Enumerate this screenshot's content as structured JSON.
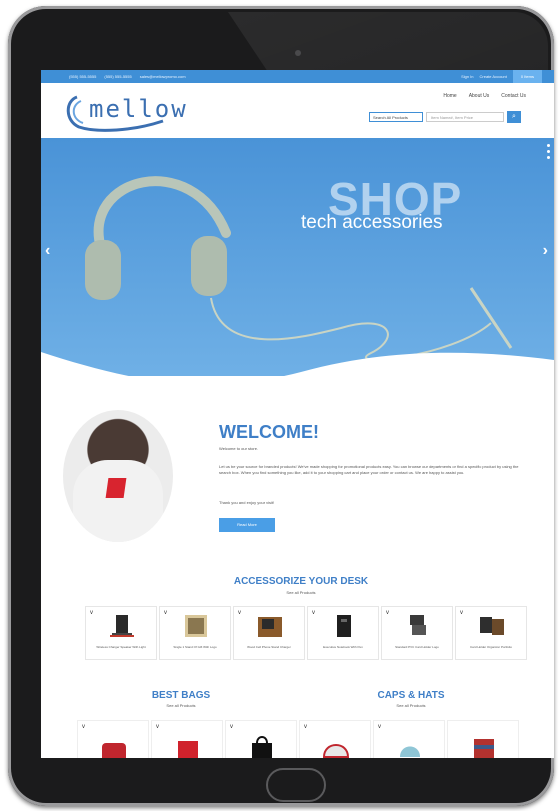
{
  "topbar": {
    "phone": "(555) 555-5555",
    "fax": "(555) 555-5555",
    "email": "sales@mellowpromo.com",
    "sign_in": "Sign In",
    "create_account": "Create Account",
    "cart": "0 Items"
  },
  "header": {
    "logo": "mellow",
    "nav": [
      "Home",
      "About Us",
      "Contact Us"
    ],
    "search_select": "Search All Products",
    "search_placeholder": "Item Name#, Item Price"
  },
  "hero": {
    "title": "SHOP",
    "subtitle": "tech accessories"
  },
  "welcome": {
    "title": "WELCOME!",
    "intro": "Welcome to our store.",
    "body": "Let us be your source for branded products! We've made shopping for promotional products easy. You can browse our departments or find a specific product by using the search box. When you find something you like, add it to your shopping cart and place your order or contact us. We are happy to assist you.",
    "thanks": "Thank you and enjoy your visit!",
    "button": "Read More"
  },
  "desk": {
    "title": "ACCESSORIZE YOUR DESK",
    "subtitle": "See all Products",
    "products": [
      {
        "name": "Wireless Charger Speaker With Light",
        "thumb": "phone-stand"
      },
      {
        "name": "Single 1 Stand Of Gift With Logo",
        "thumb": "photo-frame"
      },
      {
        "name": "Wood Cell Phone Stand Charger",
        "thumb": "wood-box"
      },
      {
        "name": "Executive Notebook With Pen",
        "thumb": "notebook"
      },
      {
        "name": "Standard PVC Card Holder Logo",
        "thumb": "card-holder"
      },
      {
        "name": "Card Holder Organizer Portfolio",
        "thumb": "portfolio"
      }
    ]
  },
  "bags": {
    "title": "BEST BAGS",
    "subtitle": "See all Products"
  },
  "caps": {
    "title": "CAPS & HATS",
    "subtitle": "See all Products"
  },
  "colors": {
    "primary": "#3f8fd6",
    "title_blue": "#3f7fc7",
    "device": "#1b1b1c"
  }
}
